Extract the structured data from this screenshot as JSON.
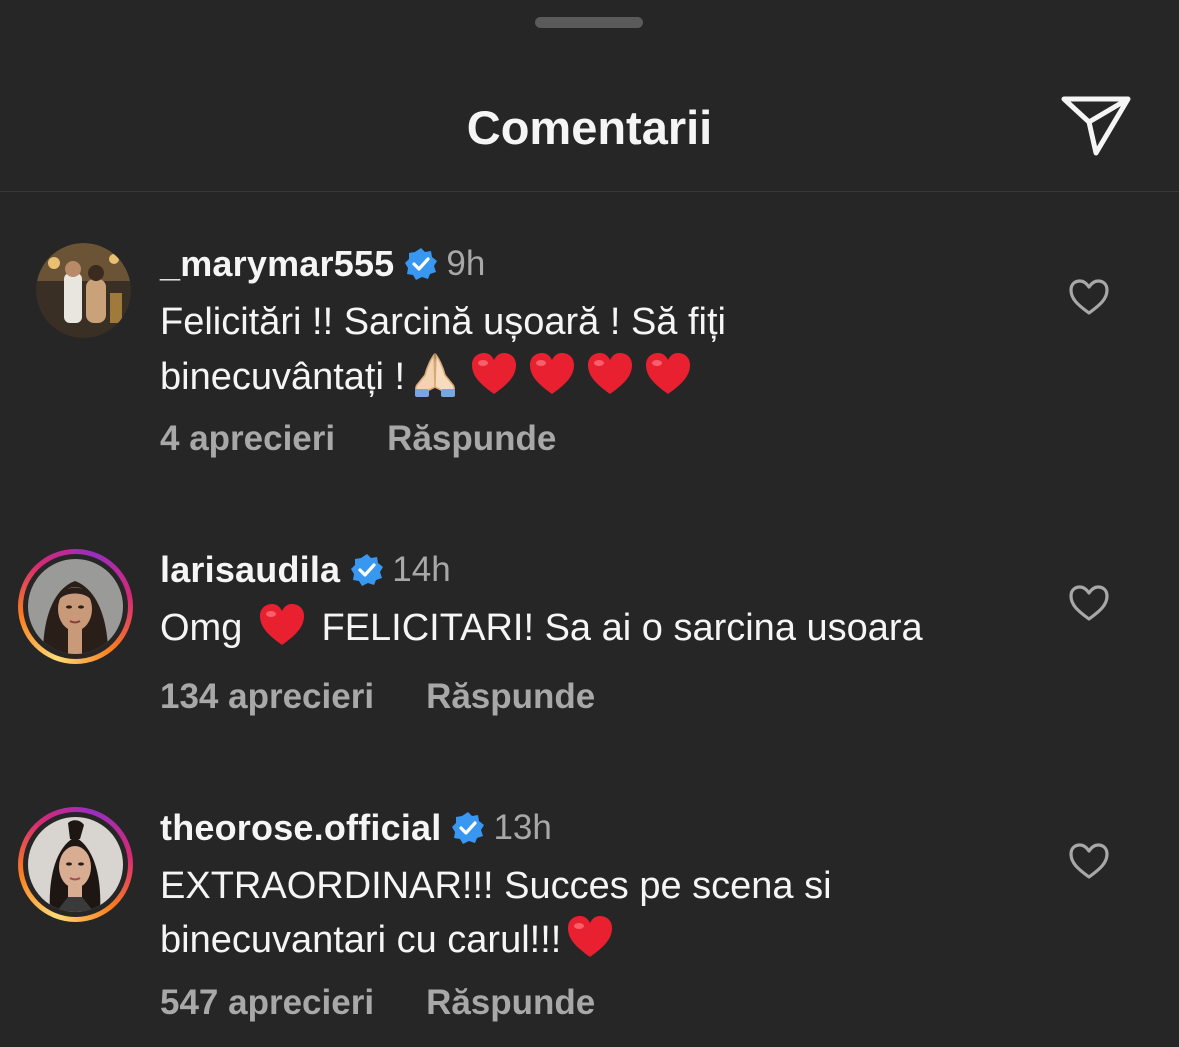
{
  "header": {
    "title": "Comentarii",
    "share_icon": "send-paper-plane-icon"
  },
  "colors": {
    "background": "#262626",
    "text_primary": "#f5f5f5",
    "text_secondary": "#a8a8a8",
    "verified_blue": "#3897f0",
    "heart_red": "#e8202f"
  },
  "comments": [
    {
      "username": "_marymar555",
      "verified": true,
      "time": "9h",
      "text_line1": "Felicitări !! Sarcină ușoară ! Să fiți",
      "text_line2_prefix": "binecuvântați !",
      "likes": "4 aprecieri",
      "reply": "Răspunde",
      "has_story_ring": false
    },
    {
      "username": "larisaudila",
      "verified": true,
      "time": "14h",
      "text_prefix": "Omg",
      "text_suffix": "FELICITARI! Sa ai o sarcina usoara",
      "likes": "134 aprecieri",
      "reply": "Răspunde",
      "has_story_ring": true
    },
    {
      "username": "theorose.official",
      "verified": true,
      "time": "13h",
      "text_line1": "EXTRAORDINAR!!! Succes pe scena si",
      "text_line2_prefix": "binecuvantari cu carul!!!",
      "likes": "547 aprecieri",
      "reply": "Răspunde",
      "has_story_ring": true
    }
  ]
}
